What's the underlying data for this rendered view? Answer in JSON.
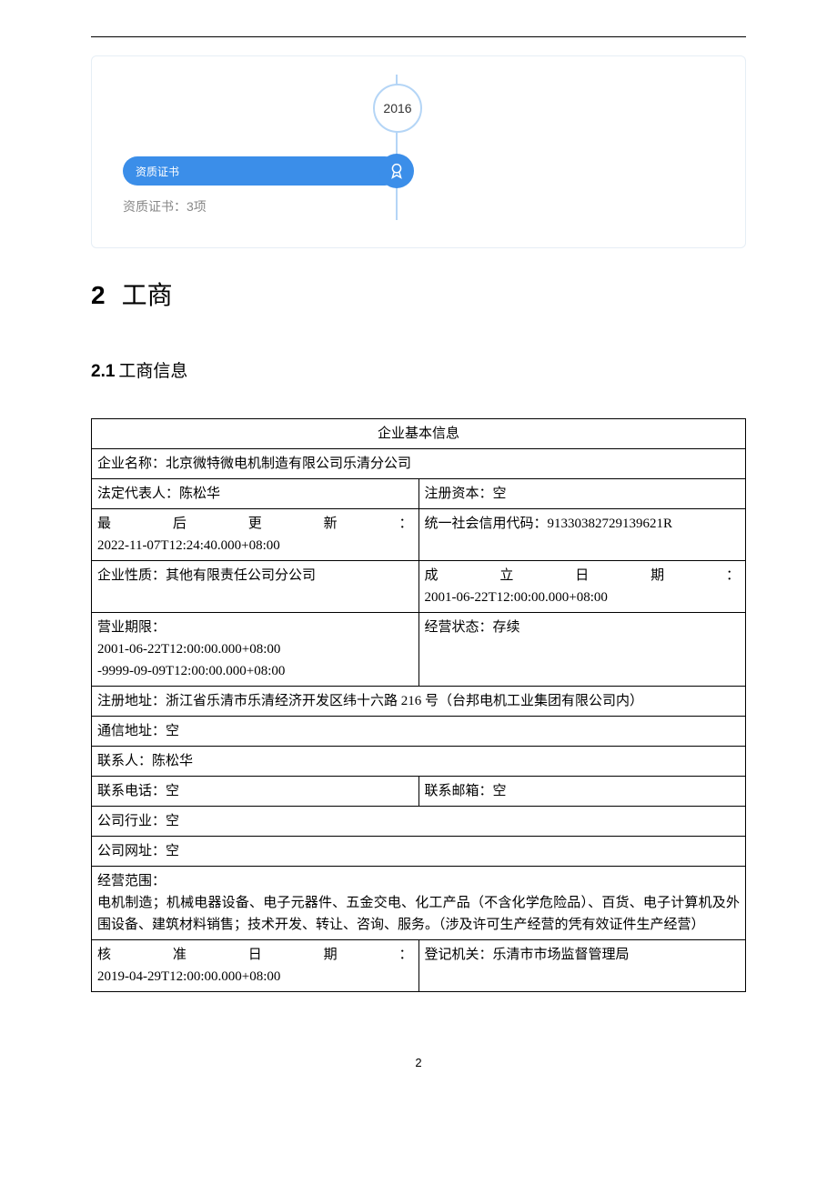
{
  "timeline": {
    "year": "2016",
    "pill_label": "资质证书",
    "cert_count_label": "资质证书：3项"
  },
  "section": {
    "number": "2",
    "title": "工商"
  },
  "subsection": {
    "number": "2.1",
    "title": "工商信息"
  },
  "table": {
    "header": "企业基本信息",
    "name_label": "企业名称：",
    "name_value": "北京微特微电机制造有限公司乐清分公司",
    "legal_label": "法定代表人：",
    "legal_value": "陈松华",
    "capital_label": "注册资本：",
    "capital_value": "空",
    "update_label": "最后更新：",
    "update_value": "2022-11-07T12:24:40.000+08:00",
    "uscc_label": "统一社会信用代码：",
    "uscc_value": "91330382729139621R",
    "nature_label": "企业性质：",
    "nature_value": "其他有限责任公司分公司",
    "estab_label": "成立日期：",
    "estab_value": "2001-06-22T12:00:00.000+08:00",
    "term_label": "营业期限：",
    "term_value1": "2001-06-22T12:00:00.000+08:00",
    "term_value2": "-9999-09-09T12:00:00.000+08:00",
    "status_label": "经营状态：",
    "status_value": "存续",
    "regaddr_label": "注册地址：",
    "regaddr_value": "浙江省乐清市乐清经济开发区纬十六路 216 号（台邦电机工业集团有限公司内）",
    "mailaddr_label": "通信地址：",
    "mailaddr_value": "空",
    "contact_label": "联系人：",
    "contact_value": "陈松华",
    "phone_label": "联系电话：",
    "phone_value": "空",
    "email_label": "联系邮箱：",
    "email_value": "空",
    "industry_label": "公司行业：",
    "industry_value": "空",
    "website_label": "公司网址：",
    "website_value": "空",
    "scope_label": "经营范围：",
    "scope_value": "电机制造；机械电器设备、电子元器件、五金交电、化工产品（不含化学危险品）、百货、电子计算机及外围设备、建筑材料销售；技术开发、转让、咨询、服务。（涉及许可生产经营的凭有效证件生产经营）",
    "approve_label": "核准日期：",
    "approve_value": "2019-04-29T12:00:00.000+08:00",
    "regorg_label": "登记机关：",
    "regorg_value": "乐清市市场监督管理局"
  },
  "page_number": "2"
}
